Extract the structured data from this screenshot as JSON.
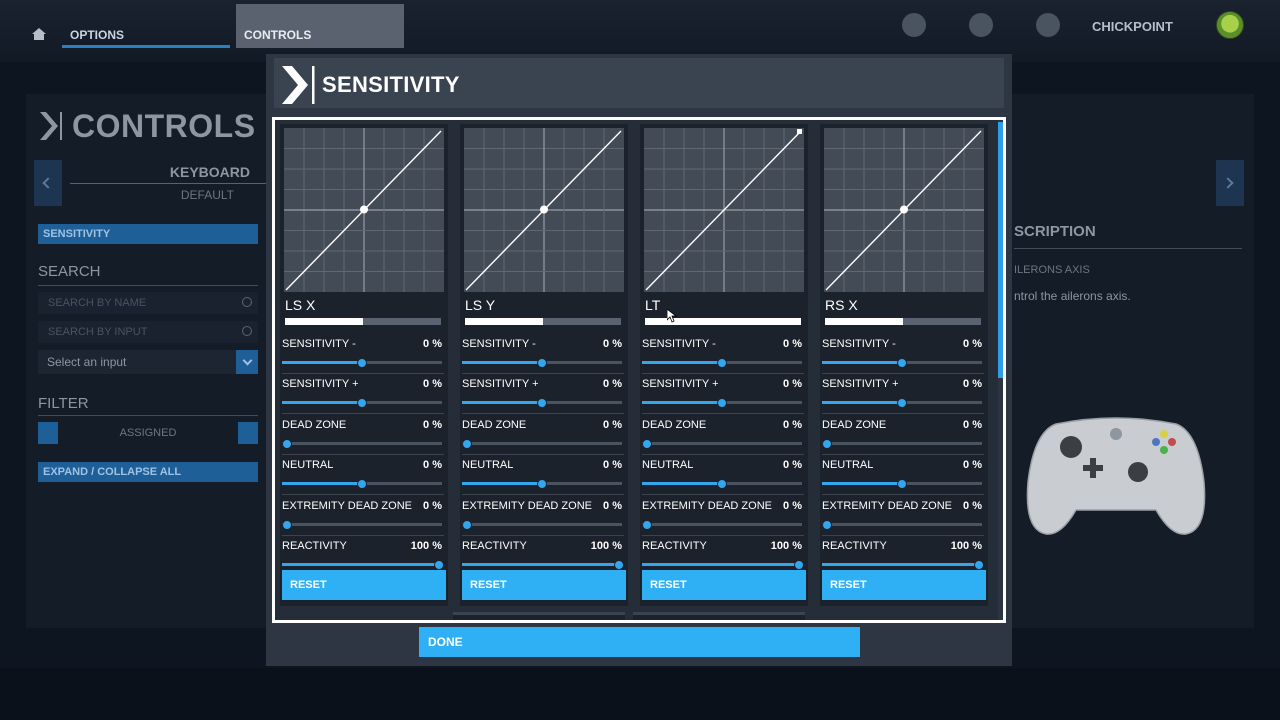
{
  "topbar": {
    "tabs": [
      {
        "label": "OPTIONS"
      },
      {
        "label": "CONTROLS"
      }
    ],
    "username": "CHICKPOINT"
  },
  "background": {
    "page_title": "CONTROLS",
    "device": "KEYBOARD",
    "profile": "DEFAULT",
    "selected_category": "SENSITIVITY",
    "search_heading": "SEARCH",
    "search_by_name_placeholder": "SEARCH BY NAME",
    "search_by_input_placeholder": "SEARCH BY INPUT",
    "select_input": "Select an input",
    "filter_heading": "FILTER",
    "filter_value": "ASSIGNED",
    "expand_collapse": "EXPAND / COLLAPSE ALL",
    "description_heading": "SCRIPTION",
    "description_sub": "ILERONS AXIS",
    "description_text": "ntrol the ailerons axis."
  },
  "modal": {
    "title": "SENSITIVITY",
    "done_label": "DONE",
    "setting_labels": [
      "SENSITIVITY -",
      "SENSITIVITY +",
      "DEAD ZONE",
      "NEUTRAL",
      "EXTREMITY DEAD ZONE",
      "REACTIVITY"
    ],
    "reset_label": "RESET",
    "scroll_position": 0.0,
    "axes": [
      {
        "name": "LS X",
        "input_level": 0.5,
        "curve_marker": "center",
        "settings": [
          {
            "value": "0 %",
            "slider": 0.5
          },
          {
            "value": "0 %",
            "slider": 0.5
          },
          {
            "value": "0 %",
            "slider": 0.0
          },
          {
            "value": "0 %",
            "slider": 0.5
          },
          {
            "value": "0 %",
            "slider": 0.0
          },
          {
            "value": "100 %",
            "slider": 1.0
          }
        ]
      },
      {
        "name": "LS Y",
        "input_level": 0.5,
        "curve_marker": "center",
        "settings": [
          {
            "value": "0 %",
            "slider": 0.5
          },
          {
            "value": "0 %",
            "slider": 0.5
          },
          {
            "value": "0 %",
            "slider": 0.0
          },
          {
            "value": "0 %",
            "slider": 0.5
          },
          {
            "value": "0 %",
            "slider": 0.0
          },
          {
            "value": "100 %",
            "slider": 1.0
          }
        ]
      },
      {
        "name": "LT",
        "input_level": 1.0,
        "curve_marker": "end",
        "settings": [
          {
            "value": "0 %",
            "slider": 0.5
          },
          {
            "value": "0 %",
            "slider": 0.5
          },
          {
            "value": "0 %",
            "slider": 0.0
          },
          {
            "value": "0 %",
            "slider": 0.5
          },
          {
            "value": "0 %",
            "slider": 0.0
          },
          {
            "value": "100 %",
            "slider": 1.0
          }
        ]
      },
      {
        "name": "RS X",
        "input_level": 0.5,
        "curve_marker": "center",
        "settings": [
          {
            "value": "0 %",
            "slider": 0.5
          },
          {
            "value": "0 %",
            "slider": 0.5
          },
          {
            "value": "0 %",
            "slider": 0.0
          },
          {
            "value": "0 %",
            "slider": 0.5
          },
          {
            "value": "0 %",
            "slider": 0.0
          },
          {
            "value": "100 %",
            "slider": 1.0
          }
        ]
      }
    ]
  },
  "colors": {
    "accent": "#2fb0f5",
    "slider": "#33a6ee",
    "modal_bg": "#2d3642",
    "card_bg": "#1b222c"
  }
}
